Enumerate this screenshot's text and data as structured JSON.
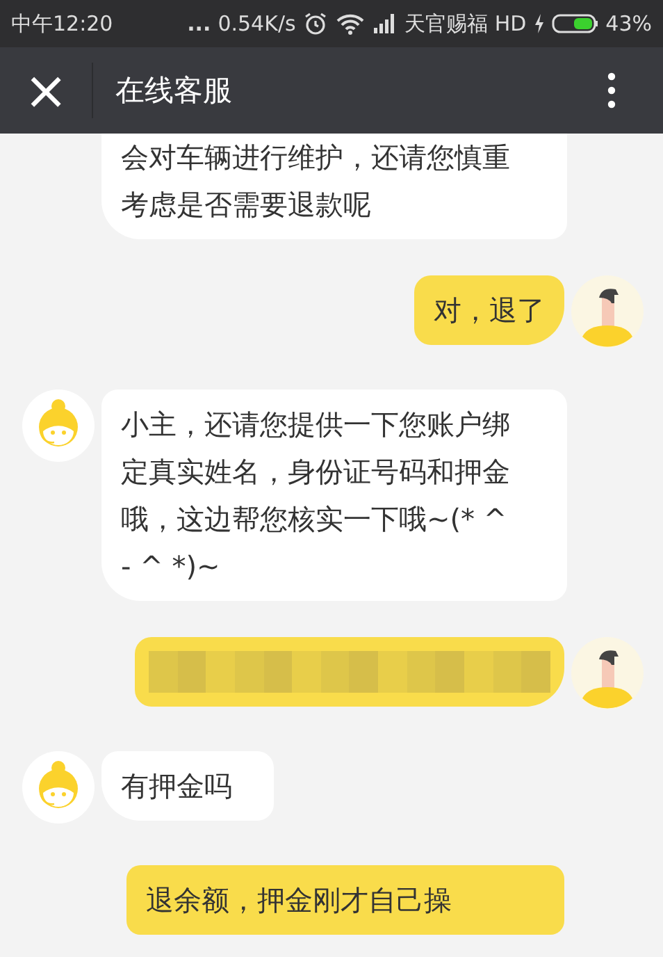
{
  "status_bar": {
    "time": "中午12:20",
    "dots": "...",
    "speed": "0.54K/s",
    "carrier": "天官赐福",
    "network": "HD",
    "battery": "43%"
  },
  "header": {
    "close": "×",
    "title": "在线客服"
  },
  "messages": [
    {
      "kind": "agent",
      "text": "会对车辆进行维护，还请您慎重考虑是否需要退款呢",
      "avatar": false,
      "cut_top": true
    },
    {
      "kind": "user",
      "text": "对，退了",
      "avatar": true,
      "cut_top": false
    },
    {
      "kind": "agent",
      "text": "小主，还请您提供一下您账户绑定真实姓名，身份证号码和押金哦，这边帮您核实一下哦~(* ^ - ^ *)~",
      "avatar": true,
      "cut_top": false
    },
    {
      "kind": "blurred",
      "avatar": true,
      "cut_top": false
    },
    {
      "kind": "agent",
      "text": "有押金吗",
      "avatar": true,
      "cut_top": false
    },
    {
      "kind": "user",
      "text": "退余额，押金刚才自己操",
      "avatar": false,
      "cut_top": false
    }
  ]
}
